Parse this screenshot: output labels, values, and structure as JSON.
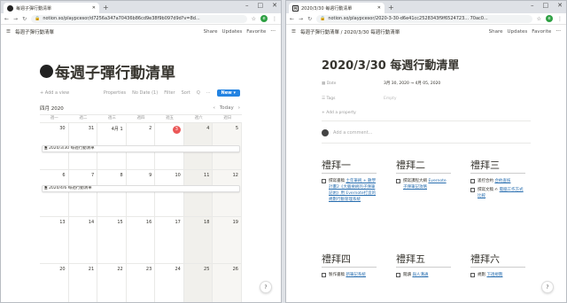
{
  "left": {
    "tab_title": "每週子彈行動清單",
    "url": "notion.so/playpcesor/d7256a347a70436b86cd9e38f9b097d9d?v=8d...",
    "breadcrumb": "每週子彈行動清單",
    "share": "Share",
    "updates": "Updates",
    "favorite": "Favorite",
    "more": "···",
    "page_title": "每週子彈行動清單",
    "view": {
      "add": "+ Add a view",
      "properties": "Properties",
      "nodate": "No Date (1)",
      "filter": "Filter",
      "sort": "Sort",
      "search": "Q",
      "more": "···",
      "new": "New ▾"
    },
    "month": "四月 2020",
    "today": "Today",
    "days": [
      "週一",
      "週二",
      "週三",
      "週四",
      "週五",
      "週六",
      "週日"
    ],
    "weeks": [
      {
        "dates": [
          "30",
          "31",
          "4月 1",
          "2",
          "3",
          "4",
          "5"
        ],
        "event": "2020/3/30 每週行動清單"
      },
      {
        "dates": [
          "6",
          "7",
          "8",
          "9",
          "10",
          "11",
          "12"
        ],
        "event": "2020/4/6 每週行動清單"
      },
      {
        "dates": [
          "13",
          "14",
          "15",
          "16",
          "17",
          "18",
          "19"
        ],
        "event": ""
      },
      {
        "dates": [
          "20",
          "21",
          "22",
          "23",
          "24",
          "25",
          "26"
        ],
        "event": ""
      }
    ],
    "help": "?"
  },
  "right": {
    "tab_title": "2020/3/30 每週行動清單",
    "url": "notion.so/playpcesor/2020-3-30-d6e41cc2528343f9f6524723... 70ac0...",
    "breadcrumb": "每週子彈行動清單  /  2020/3/30 每週行動清單",
    "share": "Share",
    "updates": "Updates",
    "favorite": "Favorite",
    "more": "···",
    "title": "2020/3/30 每週行動清單",
    "props": [
      {
        "key": "Date",
        "value": "3月 30, 2020 → 4月 05, 2020",
        "empty": false
      },
      {
        "key": "Tags",
        "value": "Empty",
        "empty": true
      }
    ],
    "add_property": "+ Add a property",
    "add_comment": "Add a comment...",
    "days": [
      {
        "name": "禮拜一",
        "items": [
          {
            "text": "撰寫書稿 ",
            "link": "土年筆刷 + 數學計畫2《大腦要刷的子彈筆記術》用 Evernote打造的規劃行動管理系統"
          }
        ]
      },
      {
        "name": "禮拜二",
        "items": [
          {
            "text": "撰寫課程大綱 ",
            "link": "Evernote 子彈筆記攻略"
          }
        ]
      },
      {
        "name": "禮拜三",
        "items": [
          {
            "text": "遙控合約 ",
            "link": "合約查核"
          },
          {
            "text": "撰寫文稿 ✍ ",
            "link": "電腦工作方式比較"
          }
        ]
      },
      {
        "name": "禮拜四",
        "items": [
          {
            "text": "製作書稿 ",
            "link": "新筆記系統"
          }
        ]
      },
      {
        "name": "禮拜五",
        "items": [
          {
            "text": "閱讀 ",
            "link": "與人溝通"
          }
        ]
      },
      {
        "name": "禮拜六",
        "items": [
          {
            "text": "規劃 ",
            "link": "下週規劃"
          }
        ]
      }
    ],
    "help": "?"
  }
}
